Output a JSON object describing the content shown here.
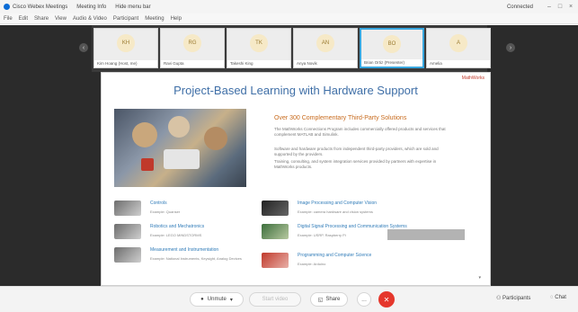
{
  "titlebar": {
    "app_name": "Cisco Webex Meetings",
    "meeting_info": "Meeting Info",
    "hide_menu": "Hide menu bar",
    "connectivity": "Connected"
  },
  "menu": [
    "File",
    "Edit",
    "Share",
    "View",
    "Audio & Video",
    "Participant",
    "Meeting",
    "Help"
  ],
  "participants": [
    {
      "initials": "KH",
      "label": "Kim Hoang (Host, me)",
      "active": false
    },
    {
      "initials": "RG",
      "label": "Ravi Gupta",
      "active": false
    },
    {
      "initials": "TK",
      "label": "Takeshi King",
      "active": false
    },
    {
      "initials": "AN",
      "label": "Anya Novik",
      "active": false
    },
    {
      "initials": "BO",
      "label": "Brian Ortiz (Presenter)",
      "active": true
    },
    {
      "initials": "A",
      "label": "Amelia",
      "active": false
    }
  ],
  "slide": {
    "brand": "MathWorks",
    "title": "Project-Based Learning with Hardware Support",
    "heading": "Over 300 Complementary Third-Party Solutions",
    "paragraph": "The MathWorks Connections Program includes commercially offered products and services that complement MATLAB and Simulink.",
    "bullets": [
      "Software and hardware products from independent third-party providers, which are sold and supported by the providers.",
      "Training, consulting, and system integration services provided by partners with expertise in MathWorks products."
    ],
    "features_left": [
      {
        "title": "Controls",
        "link": "Example: Quanser"
      },
      {
        "title": "Robotics and Mechatronics",
        "link": "Example: LEGO MINDSTORMS"
      },
      {
        "title": "Measurement and Instrumentation",
        "link": "Example: National Instruments, Keysight, Analog Devices"
      }
    ],
    "features_right": [
      {
        "title": "Image Processing and Computer Vision",
        "link": "Example: camera hardware and vision systems"
      },
      {
        "title": "Digital Signal Processing and Communication Systems",
        "link": "Example: USRP, Raspberry Pi"
      },
      {
        "title": "Programming and Computer Science",
        "link": "Example: Arduino"
      }
    ]
  },
  "controls": {
    "unmute": "Unmute",
    "start_video": "Start video",
    "share": "Share",
    "more": "...",
    "end": "✕",
    "participants": "Participants",
    "chat": "Chat"
  }
}
